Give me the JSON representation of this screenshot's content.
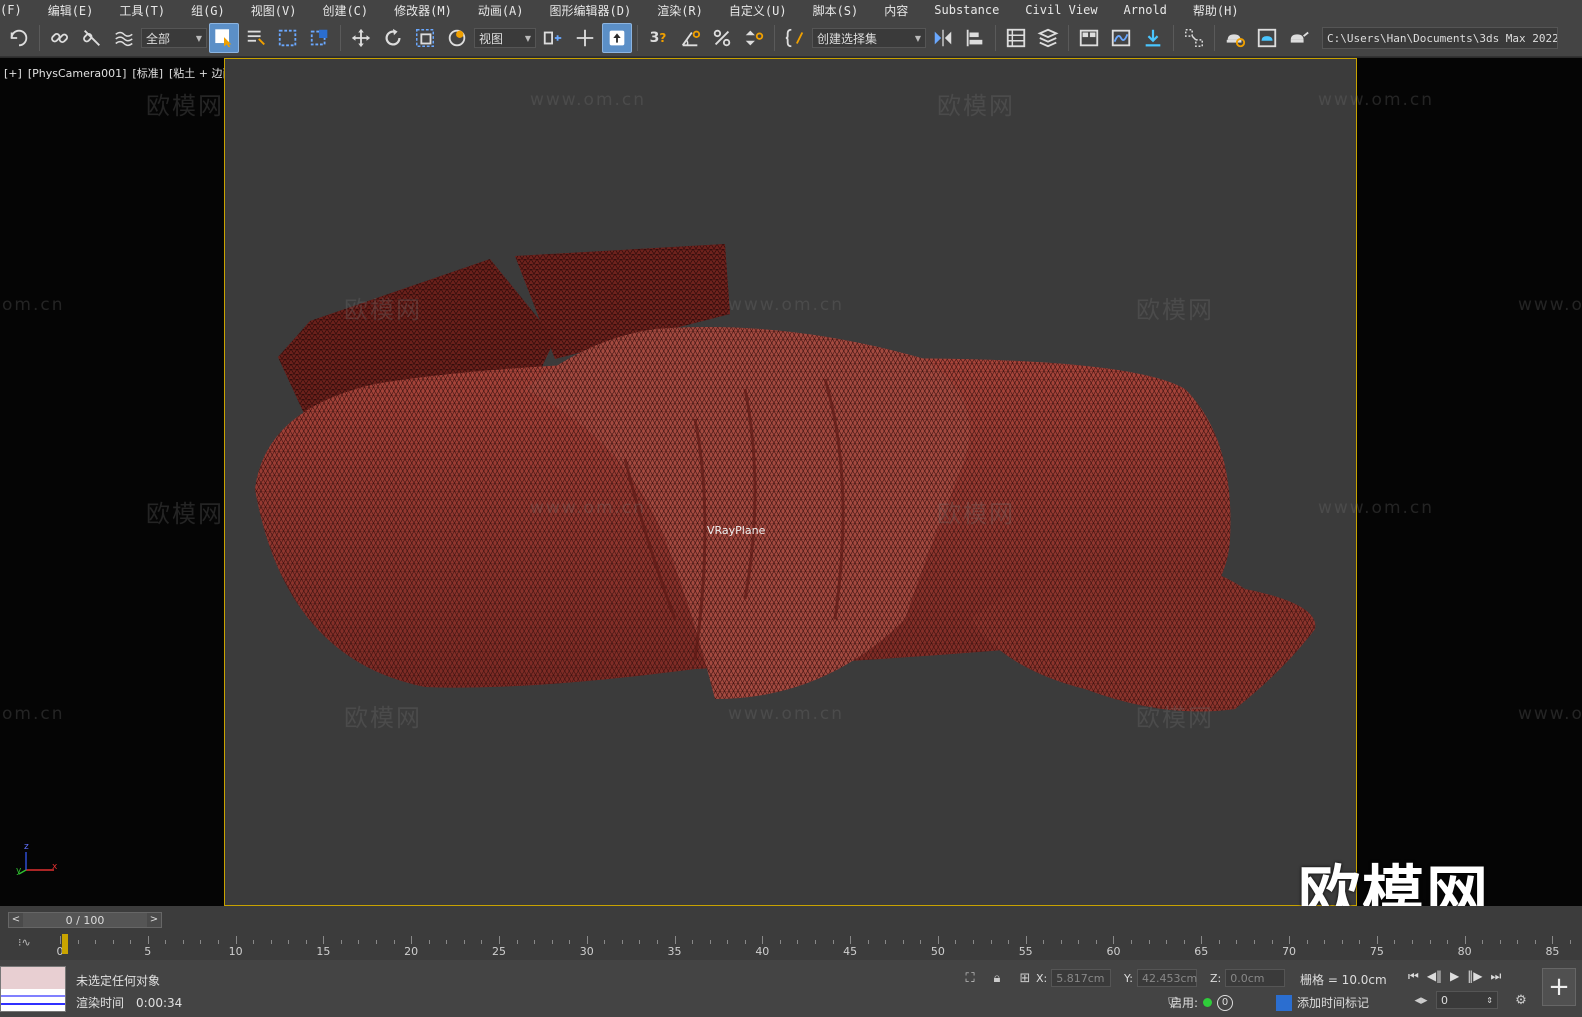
{
  "menu": [
    "(F)",
    "编辑(E)",
    "工具(T)",
    "组(G)",
    "视图(V)",
    "创建(C)",
    "修改器(M)",
    "动画(A)",
    "图形编辑器(D)",
    "渲染(R)",
    "自定义(U)",
    "脚本(S)",
    "内容",
    "Substance",
    "Civil View",
    "Arnold",
    "帮助(H)"
  ],
  "toolbar": {
    "selection_filter": "全部",
    "reference_coord": "视图",
    "snap_3": "3",
    "named_selection": "创建选择集",
    "path": "C:\\Users\\Han\\Documents\\3ds Max 2022"
  },
  "viewport": {
    "label_plus": "[+]",
    "label_camera": "[PhysCamera001]",
    "label_mode": "[标准]",
    "label_shading": "[粘土 + 边面]",
    "object_label": "VRayPlane",
    "watermark_cn": "欧模网",
    "watermark_url": "www.om.cn",
    "watermark_partial": "om.cn",
    "logo": "欧模网",
    "axis_x": "x",
    "axis_y": "y",
    "axis_z": "z"
  },
  "timeline": {
    "slider_text": "0 / 100",
    "ticks": [
      "0",
      "5",
      "10",
      "15",
      "20",
      "25",
      "30",
      "35",
      "40",
      "45",
      "50",
      "55",
      "60",
      "65",
      "70",
      "75",
      "80",
      "85"
    ]
  },
  "status": {
    "selection": "未选定任何对象",
    "render_time_label": "渲染时间",
    "render_time": "0:00:34",
    "x_label": "X:",
    "x_value": "5.817cm",
    "y_label": "Y:",
    "y_value": "42.453cm",
    "z_label": "Z:",
    "z_value": "0.0cm",
    "grid": "栅格 = 10.0cm",
    "enable": "启用:",
    "enable_count": "0",
    "add_time_tag": "添加时间标记",
    "frame": "0"
  },
  "colors": {
    "mesh": "#9b3a33",
    "frame_border": "#c7a200",
    "viewport_bg": "#3b3b3b"
  }
}
